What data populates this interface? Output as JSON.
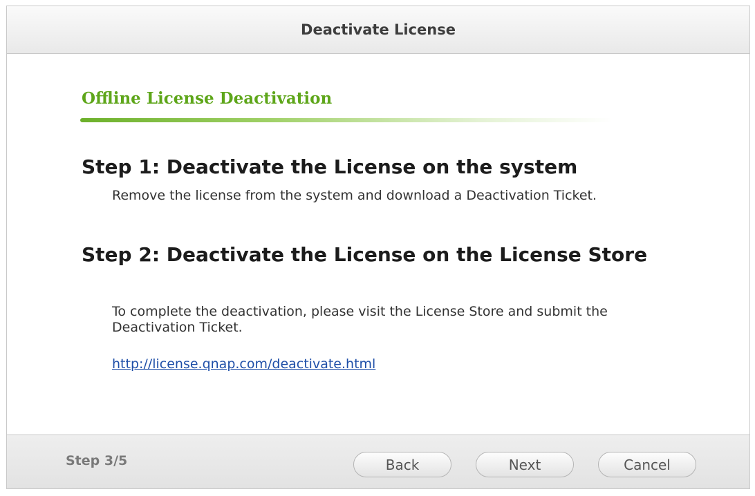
{
  "dialog": {
    "title": "Deactivate License"
  },
  "content": {
    "section_title": "Offline License Deactivation",
    "steps": [
      {
        "heading": "Step 1: Deactivate the License on the system",
        "description": "Remove the license from the system and download a Deactivation Ticket."
      },
      {
        "heading": "Step 2: Deactivate the License on the License Store",
        "description": "To complete the deactivation, please visit the License Store and submit the Deactivation Ticket."
      }
    ],
    "link_text": "http://license.qnap.com/deactivate.html"
  },
  "footer": {
    "step_indicator": "Step 3/5",
    "back_label": "Back",
    "next_label": "Next",
    "cancel_label": "Cancel"
  },
  "colors": {
    "section_title": "#5ea61a",
    "link": "#1f4fa8"
  }
}
